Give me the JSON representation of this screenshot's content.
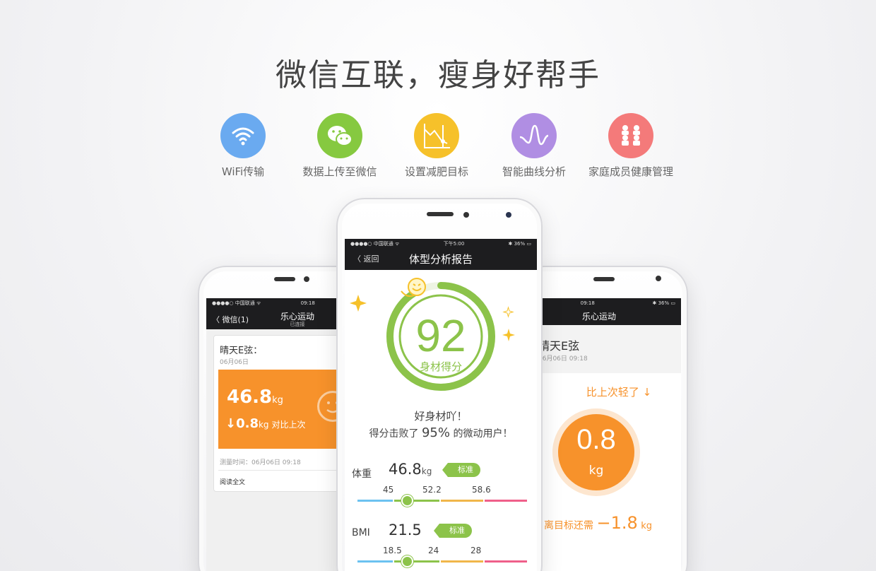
{
  "headline": "微信互联，瘦身好帮手",
  "features": [
    {
      "label": "WiFi传输",
      "icon": "wifi-icon",
      "color": "#6aaaf0"
    },
    {
      "label": "数据上传至微信",
      "icon": "wechat-icon",
      "color": "#86c940"
    },
    {
      "label": "设置减肥目标",
      "icon": "chart-goal-icon",
      "color": "#f6c12a"
    },
    {
      "label": "智能曲线分析",
      "icon": "wave-icon",
      "color": "#b08ee3"
    },
    {
      "label": "家庭成员健康管理",
      "icon": "family-icon",
      "color": "#f47a7a"
    }
  ],
  "center_phone": {
    "status": {
      "carrier": "●●●●○ 中国联通 ᯤ",
      "time": "下午5:00",
      "battery": "✱ 36% ▭"
    },
    "back_label": "〈  返回",
    "title": "体型分析报告",
    "score": "92",
    "score_fraction": 0.92,
    "score_label": "身材得分",
    "praise": "好身材吖！",
    "beat_prefix": "得分击败了",
    "beat_percent": "95%",
    "beat_suffix": "的微动用户！",
    "weight": {
      "name": "体重",
      "value": "46.8",
      "unit": "kg",
      "badge": "标准",
      "ticks": [
        "45",
        "52.2",
        "58.6"
      ]
    },
    "bmi": {
      "name": "BMI",
      "value": "21.5",
      "badge": "标准",
      "ticks": [
        "18.5",
        "24",
        "28"
      ]
    }
  },
  "left_phone": {
    "status": {
      "carrier": "●●●●○ 中国联通 ᯤ",
      "time": "09:18"
    },
    "back_label": "〈 微信(1)",
    "title": "乐心运动",
    "subtitle": "已连接",
    "card": {
      "who": "晴天E弦：",
      "date": "06月06日",
      "weight": "46.8",
      "unit": "kg",
      "diff": "↓0.8",
      "diff_unit": "kg",
      "diff_text": "对比上次",
      "measure_time": "测量时间：06月06日  09:18",
      "read_all": "阅读全文"
    }
  },
  "right_phone": {
    "status": {
      "time": "09:18",
      "battery": "✱ 36% ▭"
    },
    "title": "乐心运动",
    "name": "晴天E弦",
    "time": "06月06日  09:18",
    "lighter": "比上次轻了 ↓",
    "value": "0.8",
    "unit": "kg",
    "goal_prefix": "离目标还需",
    "goal_value": "−1.8",
    "goal_unit": "kg"
  }
}
